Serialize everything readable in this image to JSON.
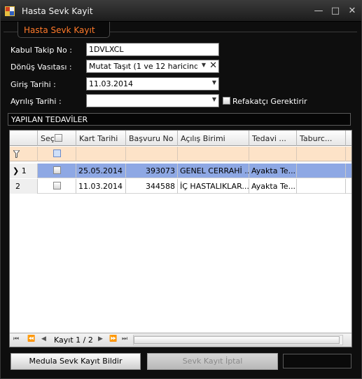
{
  "window": {
    "title": "Hasta Sevk Kayit",
    "minimize": "—",
    "maximize": "□",
    "close": "✕"
  },
  "group": {
    "title": "Hasta Sevk Kayıt"
  },
  "form": {
    "kabul_label": "Kabul Takip No :",
    "kabul_value": "1DVLXCL",
    "donus_label": "Dönüş Vasıtası :",
    "donus_value": "Mutat Taşıt (1 ve 12 haricind…",
    "giris_label": "Giriş Tarihi :",
    "giris_value": "11.03.2014",
    "ayrilis_label": "Ayrılış Tarihi :",
    "ayrilis_value": "",
    "refakatci_label": "Refakatçı Gerektirir"
  },
  "section": {
    "title": "YAPILAN TEDAVİLER"
  },
  "grid": {
    "columns": [
      "",
      "Seç",
      "Kart Tarihi",
      "Başvuru No",
      "Açılış Birimi",
      "Tedavi ...",
      "Taburc..."
    ],
    "rows": [
      {
        "row_no": "1",
        "selected": true,
        "kart_tarihi": "25.05.2014",
        "basvuru_no": "393073",
        "acilis_birimi": "GENEL CERRAHİ ...",
        "tedavi": "Ayakta Te...",
        "taburcu": ""
      },
      {
        "row_no": "2",
        "selected": false,
        "kart_tarihi": "11.03.2014",
        "basvuru_no": "344588",
        "acilis_birimi": "İÇ HASTALIKLAR...",
        "tedavi": "Ayakta Te...",
        "taburcu": ""
      }
    ],
    "navigator": "Kayıt 1 / 2"
  },
  "buttons": {
    "medula": "Medula Sevk Kayıt Bildir",
    "iptal": "Sevk Kayıt İptal"
  },
  "colors": {
    "accent": "#ff7a2a",
    "selected_row": "#8ea8e4",
    "filter_row": "#fde3c8"
  }
}
